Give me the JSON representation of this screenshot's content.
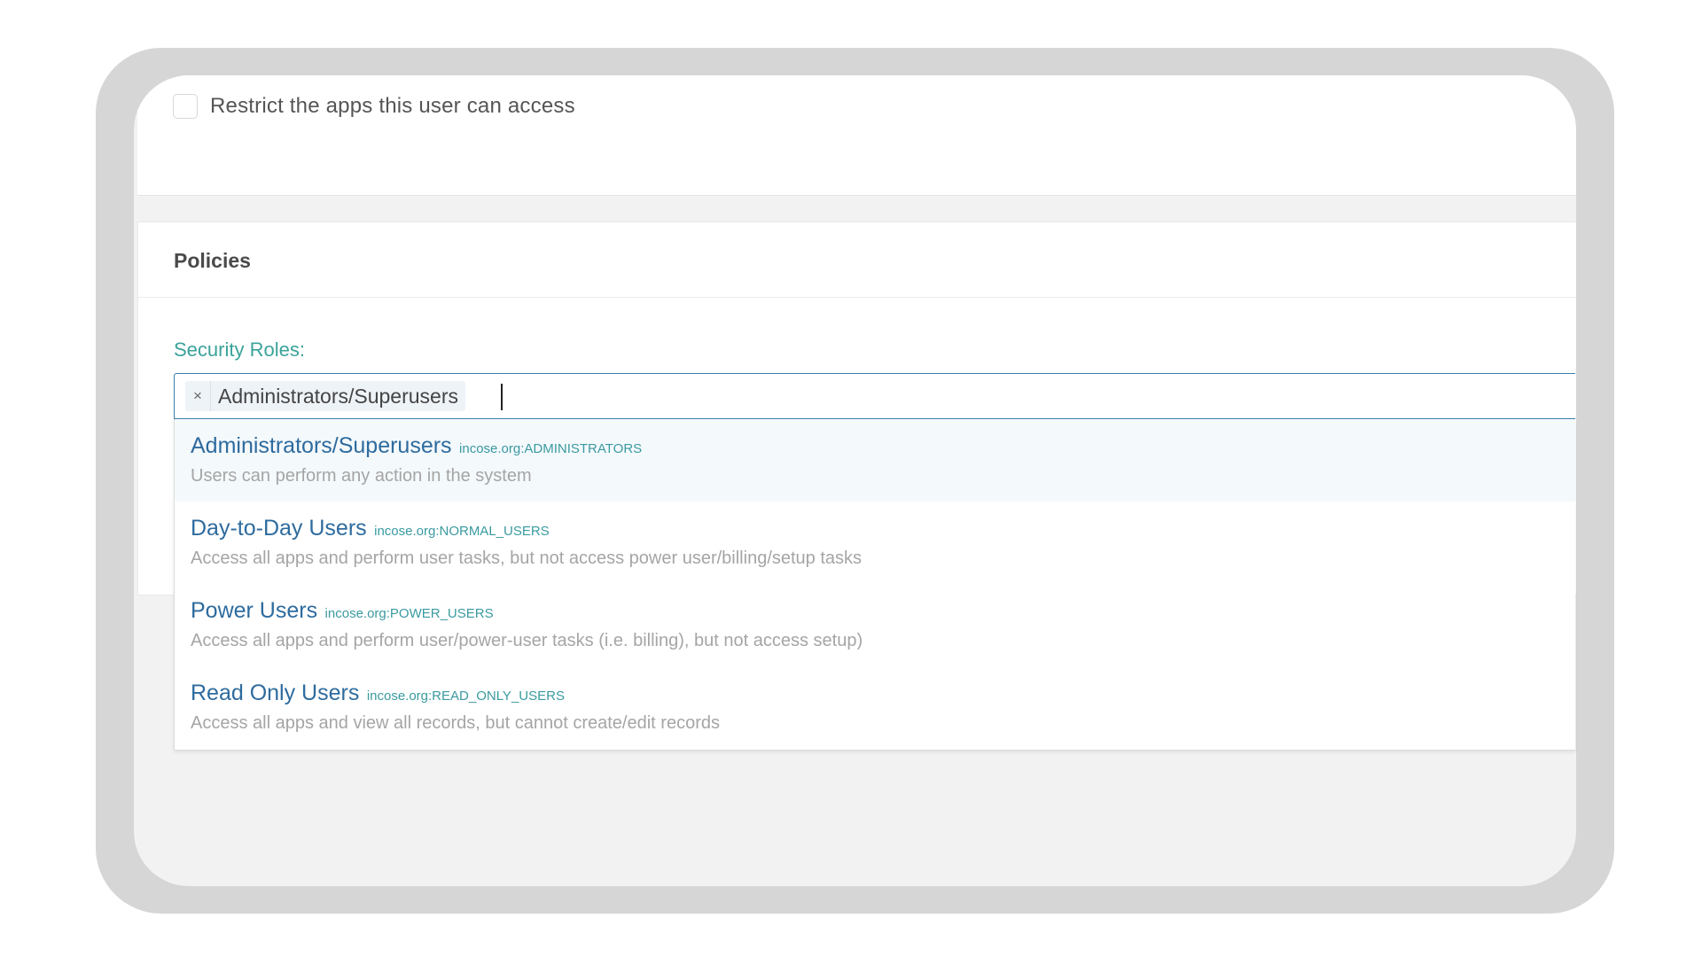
{
  "restrict_apps": {
    "label": "Restrict the apps this user can access",
    "checked": false
  },
  "policies": {
    "title": "Policies",
    "security_roles_label": "Security Roles:",
    "selected_chip": {
      "remove_symbol": "×",
      "label": "Administrators/Superusers"
    },
    "options": [
      {
        "name": "Administrators/Superusers",
        "code": "incose.org:ADMINISTRATORS",
        "description": "Users can perform any action in the system"
      },
      {
        "name": "Day-to-Day Users",
        "code": "incose.org:NORMAL_USERS",
        "description": "Access all apps and perform user tasks, but not access power user/billing/setup tasks"
      },
      {
        "name": "Power Users",
        "code": "incose.org:POWER_USERS",
        "description": "Access all apps and perform user/power-user tasks (i.e. billing), but not access setup)"
      },
      {
        "name": "Read Only Users",
        "code": "incose.org:READ_ONLY_USERS",
        "description": "Access all apps and view all records, but cannot create/edit records"
      }
    ]
  },
  "colors": {
    "accent_teal": "#3aa39a",
    "link_blue": "#2e6b9e",
    "focus_border": "#3a7fa8"
  }
}
